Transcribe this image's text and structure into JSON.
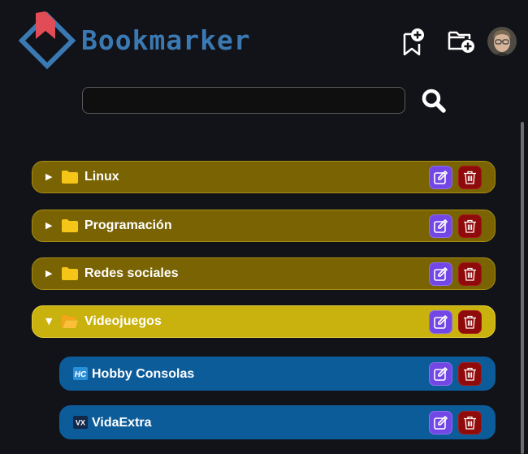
{
  "header": {
    "title": "Bookmarker",
    "logo_icon": "bookmark-diamond-logo",
    "add_bookmark_icon": "bookmark-plus-icon",
    "add_folder_icon": "folder-plus-icon",
    "avatar_icon": "user-avatar"
  },
  "search": {
    "value": "",
    "placeholder": "",
    "button_icon": "search-icon"
  },
  "colors": {
    "background": "#121219",
    "brand_blue": "#3a79b1",
    "brand_red": "#e24c56",
    "folder_collapsed": "#7a6303",
    "folder_expanded": "#c9b20d",
    "bookmark_row": "#0d5c9a",
    "edit_button": "#7347e6",
    "delete_button": "#8f0a0a"
  },
  "tree": {
    "folders": [
      {
        "label": "Linux",
        "expanded": false,
        "toggle": "▶"
      },
      {
        "label": "Programación",
        "expanded": false,
        "toggle": "▶"
      },
      {
        "label": "Redes sociales",
        "expanded": false,
        "toggle": "▶"
      },
      {
        "label": "Videojuegos",
        "expanded": true,
        "toggle": "▼"
      }
    ],
    "bookmarks": [
      {
        "label": "Hobby Consolas",
        "favicon": "HC"
      },
      {
        "label": "VidaExtra",
        "favicon": "VX"
      }
    ],
    "row_actions": {
      "edit_icon": "edit-icon",
      "delete_icon": "trash-icon"
    }
  }
}
